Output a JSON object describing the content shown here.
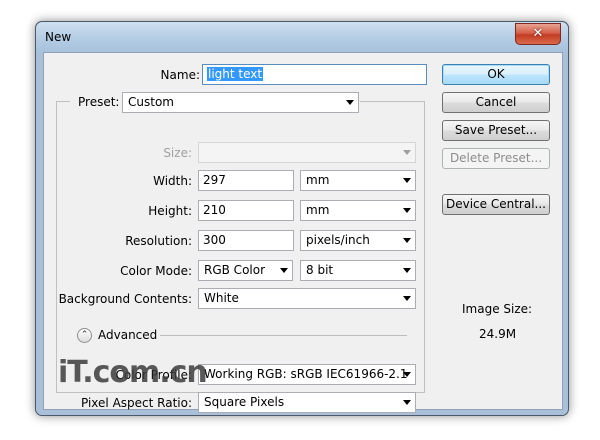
{
  "window": {
    "title": "New",
    "close_glyph": "✕"
  },
  "form": {
    "name_label": "Name:",
    "name_value": "light text",
    "preset_label": "Preset:",
    "preset_value": "Custom",
    "size_label": "Size:",
    "size_value": "",
    "width_label": "Width:",
    "width_value": "297",
    "width_unit": "mm",
    "height_label": "Height:",
    "height_value": "210",
    "height_unit": "mm",
    "resolution_label": "Resolution:",
    "resolution_value": "300",
    "resolution_unit": "pixels/inch",
    "color_mode_label": "Color Mode:",
    "color_mode_value": "RGB Color",
    "bit_depth_value": "8 bit",
    "background_label": "Background Contents:",
    "background_value": "White",
    "advanced_label": "Advanced",
    "color_profile_label": "Color Profile:",
    "color_profile_value": "Working RGB:  sRGB IEC61966-2.1",
    "pixel_aspect_label": "Pixel Aspect Ratio:",
    "pixel_aspect_value": "Square Pixels"
  },
  "buttons": {
    "ok": "OK",
    "cancel": "Cancel",
    "save_preset": "Save Preset...",
    "delete_preset": "Delete Preset...",
    "device_central": "Device Central..."
  },
  "image_size": {
    "label": "Image Size:",
    "value": "24.9M"
  },
  "watermark": "iT.com.cn",
  "icons": {
    "close": "close-icon",
    "advanced_toggle": "chevron-up-icon",
    "dropdown": "chevron-down-icon"
  },
  "colors": {
    "title_bar": "#b4cce4",
    "close_button": "#c33b22",
    "selection": "#3399ff",
    "client_bg": "#f0f0f0"
  }
}
